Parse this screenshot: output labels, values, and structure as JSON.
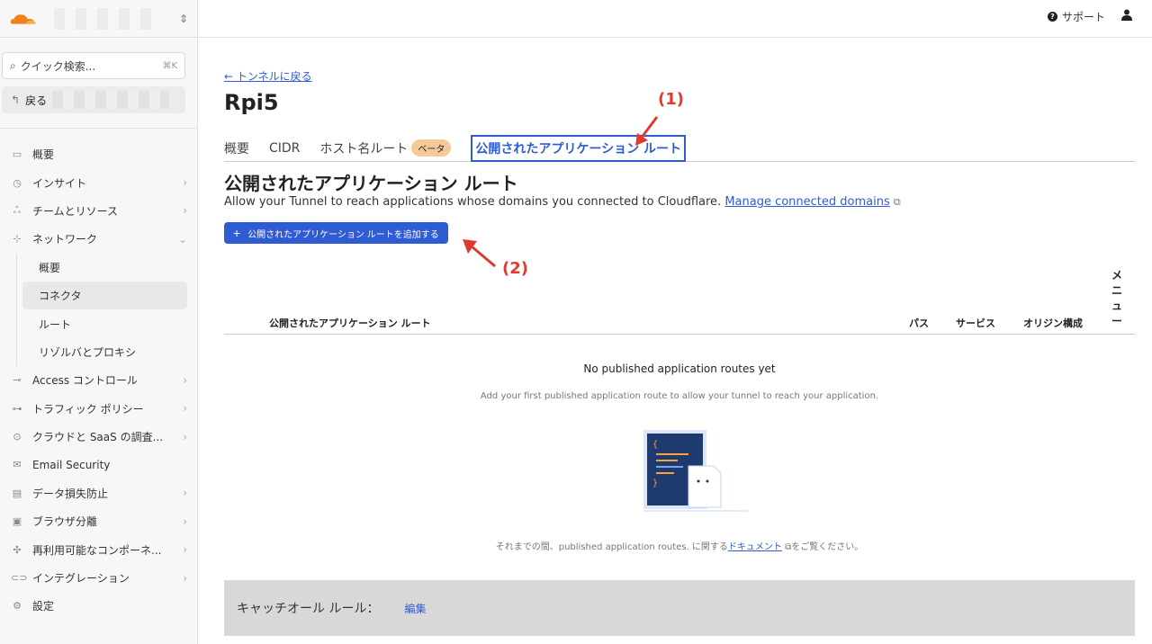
{
  "sidebar": {
    "search": {
      "label": "クイック検索...",
      "shortcut": "⌘K"
    },
    "back_label": "戻る",
    "items": [
      {
        "label": "概要",
        "icon": "window-icon",
        "chevron": false
      },
      {
        "label": "インサイト",
        "icon": "clock-icon",
        "chevron": true
      },
      {
        "label": "チームとリソース",
        "icon": "team-icon",
        "chevron": true
      },
      {
        "label": "ネットワーク",
        "icon": "network-icon",
        "chevron": "down"
      }
    ],
    "network_sub": [
      {
        "label": "概要",
        "active": false
      },
      {
        "label": "コネクタ",
        "active": true
      },
      {
        "label": "ルート",
        "active": false
      },
      {
        "label": "リゾルバとプロキシ",
        "active": false
      }
    ],
    "items_after": [
      {
        "label": "Access コントロール",
        "icon": "access-icon",
        "chevron": true
      },
      {
        "label": "トラフィック ポリシー",
        "icon": "traffic-icon",
        "chevron": true
      },
      {
        "label": "クラウドと SaaS の調査...",
        "icon": "cloud-icon",
        "chevron": true
      },
      {
        "label": "Email Security",
        "icon": "email-security-icon",
        "chevron": false
      },
      {
        "label": "データ損失防止",
        "icon": "dlp-icon",
        "chevron": true
      },
      {
        "label": "ブラウザ分離",
        "icon": "browser-icon",
        "chevron": true
      },
      {
        "label": "再利用可能なコンポーネ...",
        "icon": "components-icon",
        "chevron": true
      },
      {
        "label": "インテグレーション",
        "icon": "integration-icon",
        "chevron": true
      },
      {
        "label": "設定",
        "icon": "gear-icon",
        "chevron": false
      }
    ]
  },
  "topbar": {
    "support_label": "サポート"
  },
  "main": {
    "back_link": "← トンネルに戻る",
    "title": "Rpi5",
    "tabs": [
      {
        "label": "概要"
      },
      {
        "label": "CIDR"
      },
      {
        "label": "ホスト名ルート",
        "badge": "ベータ"
      },
      {
        "label": "公開されたアプリケーション ルート",
        "active": true
      }
    ],
    "section_title": "公開されたアプリケーション ルート",
    "description": "Allow your Tunnel to reach applications whose domains you connected to Cloudflare.",
    "manage_link": "Manage connected domains",
    "add_button": "公開されたアプリケーション ルートを追加する",
    "menu_col": "メニュー",
    "table_headers": {
      "route": "公開されたアプリケーション ルート",
      "path": "パス",
      "service": "サービス",
      "origin": "オリジン構成"
    },
    "empty_title": "No published application routes yet",
    "empty_sub": "Add your first published application route to allow your tunnel to reach your application.",
    "doc_note_pre": "それまでの間、published application routes. に関する",
    "doc_link": "ドキュメント",
    "doc_note_post": "をご覧ください。",
    "catchall_label": "キャッチオール ルール：",
    "catchall_edit": "編集"
  },
  "annotations": {
    "a1": "(1)",
    "a2": "(2)",
    "color": "#e03a2e"
  },
  "colors": {
    "accent": "#2f5bd3",
    "badge": "#f6c99a",
    "logo": "#f38020"
  }
}
